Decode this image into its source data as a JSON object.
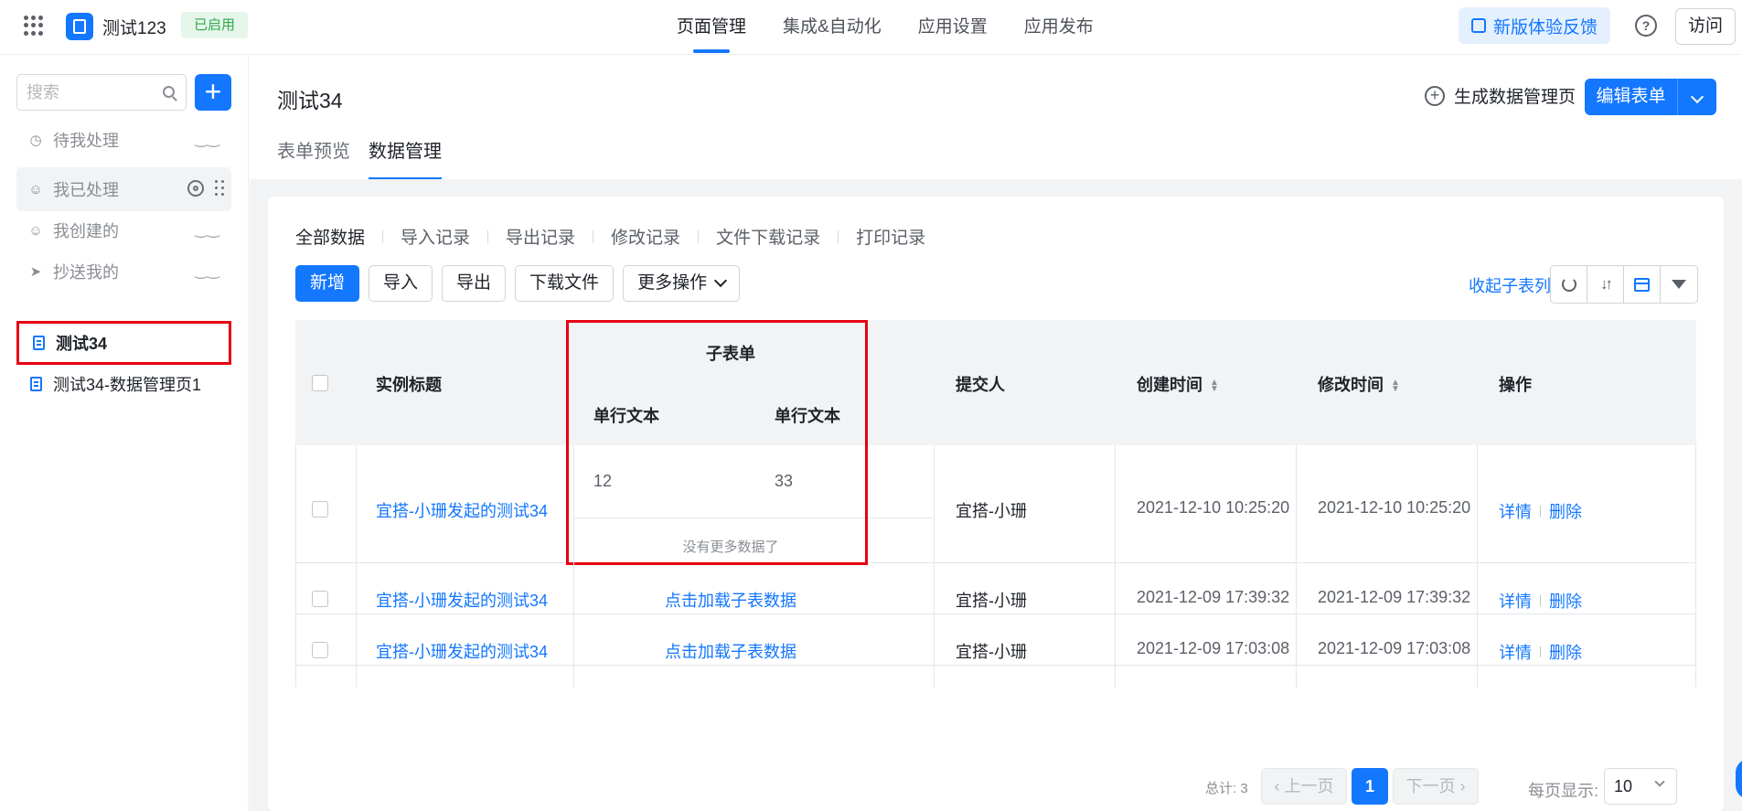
{
  "app": {
    "name": "测试123",
    "status": "已启用"
  },
  "topnav": [
    "页面管理",
    "集成&自动化",
    "应用设置",
    "应用发布"
  ],
  "topnav_active": 0,
  "header": {
    "feedback": "新版体验反馈",
    "help": "?",
    "visit": "访问"
  },
  "sidebar": {
    "search_placeholder": "搜索",
    "add": "+",
    "items": [
      {
        "label": "待我处理"
      },
      {
        "label": "我已处理"
      },
      {
        "label": "我创建的"
      },
      {
        "label": "抄送我的"
      },
      {
        "label": "测试34"
      },
      {
        "label": "测试34-数据管理页1"
      }
    ]
  },
  "page": {
    "title": "测试34",
    "generate": "生成数据管理页",
    "edit_form": "编辑表单",
    "tabs": [
      "表单预览",
      "数据管理"
    ]
  },
  "subtabs": [
    "全部数据",
    "导入记录",
    "导出记录",
    "修改记录",
    "文件下载记录",
    "打印记录"
  ],
  "toolbar": {
    "add": "新增",
    "import": "导入",
    "export": "导出",
    "download": "下载文件",
    "more": "更多操作",
    "collapse": "收起子表列"
  },
  "table": {
    "headers": {
      "title": "实例标题",
      "subform": "子表单",
      "sub_col1": "单行文本",
      "sub_col2": "单行文本",
      "submitter": "提交人",
      "created": "创建时间",
      "modified": "修改时间",
      "ops": "操作"
    },
    "rows": [
      {
        "title": "宜搭-小珊发起的测试34",
        "sub1": "12",
        "sub2": "33",
        "no_more": "没有更多数据了",
        "submitter": "宜搭-小珊",
        "created": "2021-12-10 10:25:20",
        "modified": "2021-12-10 10:25:20",
        "detail": "详情",
        "delete": "删除"
      },
      {
        "title": "宜搭-小珊发起的测试34",
        "load": "点击加载子表数据",
        "submitter": "宜搭-小珊",
        "created": "2021-12-09 17:39:32",
        "modified": "2021-12-09 17:39:32",
        "detail": "详情",
        "delete": "删除"
      },
      {
        "title": "宜搭-小珊发起的测试34",
        "load": "点击加载子表数据",
        "submitter": "宜搭-小珊",
        "created": "2021-12-09 17:03:08",
        "modified": "2021-12-09 17:03:08",
        "detail": "详情",
        "delete": "删除"
      }
    ]
  },
  "pager": {
    "total": "总计: 3",
    "prev": "上一页",
    "current": "1",
    "next": "下一页",
    "page_size_label": "每页显示:",
    "page_size": "10"
  },
  "colors": {
    "accent": "#1377ff",
    "highlight": "#e60012",
    "status_bg": "#e6f6ea",
    "status_text": "#2fa84f"
  }
}
